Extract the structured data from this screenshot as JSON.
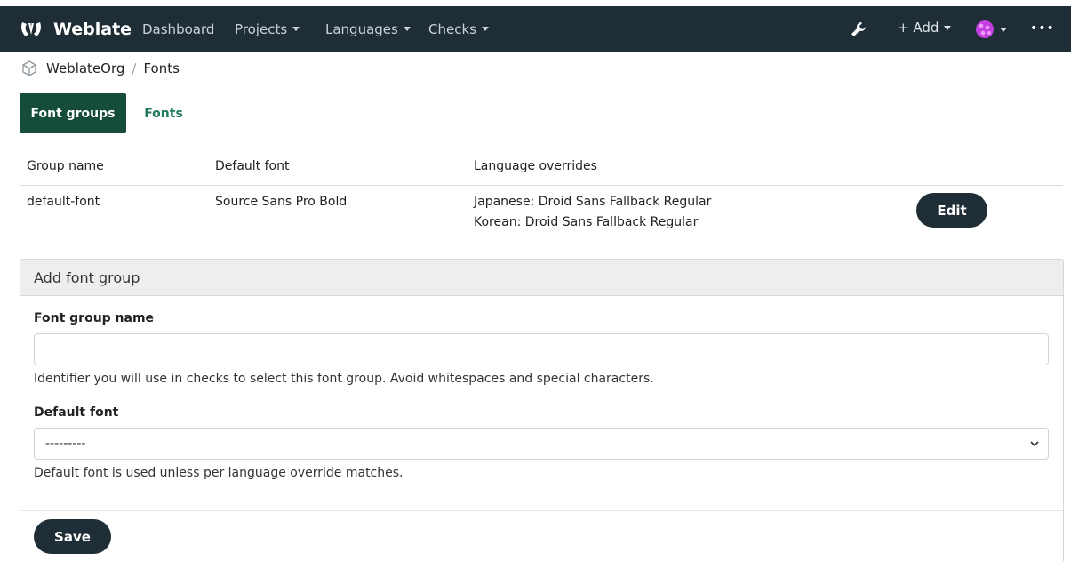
{
  "navbar": {
    "brand": "Weblate",
    "items": [
      {
        "label": "Dashboard"
      },
      {
        "label": "Projects"
      },
      {
        "label": "Languages"
      },
      {
        "label": "Checks"
      }
    ],
    "add_label": "+ Add",
    "more_label": "•••",
    "background": "#1f2d36"
  },
  "breadcrumb": {
    "org": "WeblateOrg",
    "separator": "/",
    "page": "Fonts"
  },
  "tabs": [
    {
      "label": "Font groups",
      "active": true
    },
    {
      "label": "Fonts",
      "active": false
    }
  ],
  "table": {
    "headers": [
      "Group name",
      "Default font",
      "Language overrides"
    ],
    "rows": [
      {
        "group_name": "default-font",
        "default_font": "Source Sans Pro Bold",
        "overrides": [
          "Japanese: Droid Sans Fallback Regular",
          "Korean: Droid Sans Fallback Regular"
        ],
        "action": "Edit"
      }
    ]
  },
  "form": {
    "title": "Add font group",
    "group_name_label": "Font group name",
    "group_name_value": "",
    "group_name_help": "Identifier you will use in checks to select this font group. Avoid whitespaces and special characters.",
    "default_font_label": "Default font",
    "default_font_selected": "---------",
    "default_font_help": "Default font is used unless per language override matches.",
    "save_label": "Save"
  },
  "colors": {
    "tab_active": "#164c3a",
    "link": "#1f7a5a",
    "button": "#1f2d36"
  }
}
